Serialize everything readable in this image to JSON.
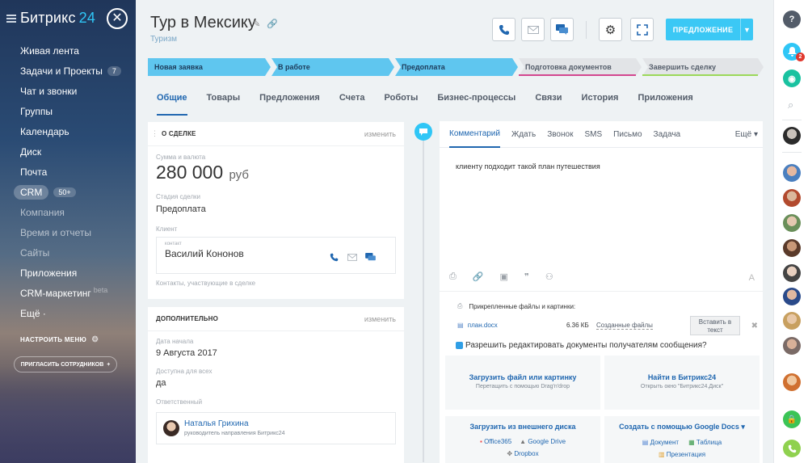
{
  "sidebar": {
    "logo_text": "Битрикс",
    "logo_num": "24",
    "items": [
      {
        "label": "Живая лента"
      },
      {
        "label": "Задачи и Проекты",
        "badge": "7"
      },
      {
        "label": "Чат и звонки"
      },
      {
        "label": "Группы"
      },
      {
        "label": "Календарь"
      },
      {
        "label": "Диск"
      },
      {
        "label": "Почта"
      },
      {
        "label": "CRM",
        "badge": "50+"
      },
      {
        "label": "Компания"
      },
      {
        "label": "Время и отчеты"
      },
      {
        "label": "Сайты"
      },
      {
        "label": "Приложения"
      },
      {
        "label": "CRM-маркетинг",
        "beta": "beta"
      },
      {
        "label": "Ещё ·"
      }
    ],
    "setup_menu": "НАСТРОИТЬ МЕНЮ",
    "invite": "ПРИГЛАСИТЬ СОТРУДНИКОВ"
  },
  "header": {
    "title": "Тур в Мексику",
    "subtitle": "Туризм",
    "offer_button": "ПРЕДЛОЖЕНИЕ"
  },
  "stages": [
    {
      "label": "Новая заявка",
      "color": "#5fc6ef"
    },
    {
      "label": "В работе",
      "color": "#5fc6ef"
    },
    {
      "label": "Предоплата",
      "color": "#5fc6ef"
    },
    {
      "label": "Подготовка документов",
      "color": "#e2e4e7",
      "line": "#d3478f"
    },
    {
      "label": "Завершить сделку",
      "color": "#e2e4e7",
      "line": "#9bd85a"
    }
  ],
  "tabs": [
    "Общие",
    "Товары",
    "Предложения",
    "Счета",
    "Роботы",
    "Бизнес-процессы",
    "Связи",
    "История",
    "Приложения"
  ],
  "deal": {
    "section_title": "О СДЕЛКЕ",
    "edit": "изменить",
    "amount_label": "Сумма и валюта",
    "amount": "280 000",
    "currency": "руб",
    "stage_label": "Стадия сделки",
    "stage": "Предоплата",
    "client_label": "Клиент",
    "contact_caption": "контакт",
    "contact_name": "Василий Кононов",
    "contacts_note": "Контакты, участвующие в сделке"
  },
  "extra": {
    "section_title": "ДОПОЛНИТЕЛЬНО",
    "edit": "изменить",
    "start_label": "Дата начала",
    "start": "9 Августа 2017",
    "available_label": "Доступна для всех",
    "available": "да",
    "resp_label": "Ответственный",
    "resp_name": "Наталья Грихина",
    "resp_role": "руководитель направления Битрикс24"
  },
  "editor": {
    "tabs": [
      "Комментарий",
      "Ждать",
      "Звонок",
      "SMS",
      "Письмо",
      "Задача"
    ],
    "more": "Ещё ▾",
    "text": "клиенту подходит такой план путешествия",
    "attach_head": "Прикрепленные файлы и картинки:",
    "file_name": "план.docx",
    "file_size": "6.36 КБ",
    "created_files": "Созданные файлы",
    "insert_l1": "Вставить в",
    "insert_l2": "текст",
    "allow_text": "Разрешить редактировать документы получателям сообщения?",
    "upload1_title": "Загрузить файл или картинку",
    "upload1_sub": "Перетащить с помощью Drag'n'drop",
    "upload2_title": "Найти в Битрикс24",
    "upload2_sub": "Открыть окно \"Битрикс24.Диск\"",
    "upload3_title": "Загрузить из внешнего диска",
    "upload3_items": [
      "Office365",
      "Google Drive",
      "Dropbox"
    ],
    "upload4_title": "Создать с помощью Google Docs ▾",
    "upload4_items": [
      "Документ",
      "Таблица",
      "Презентация"
    ]
  },
  "rightbar": {
    "help": "?",
    "notify_count": "2"
  }
}
